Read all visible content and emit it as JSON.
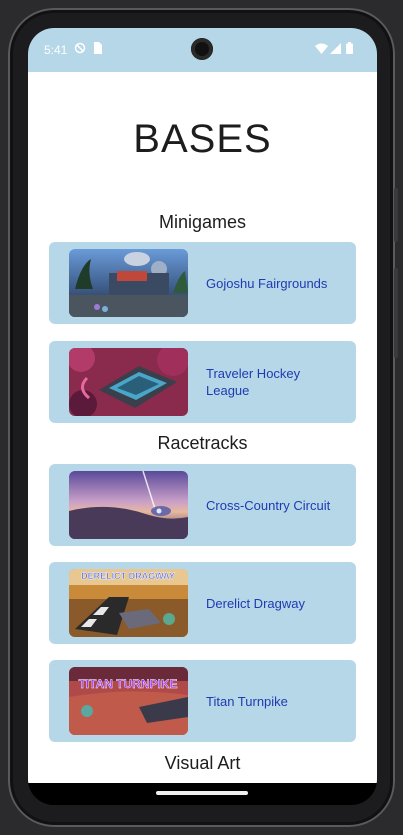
{
  "status_bar": {
    "time": "5:41"
  },
  "page": {
    "title": "BASES"
  },
  "sections": [
    {
      "title": "Minigames",
      "items": [
        {
          "label": "Gojoshu Fairgrounds"
        },
        {
          "label": "Traveler Hockey League"
        }
      ]
    },
    {
      "title": "Racetracks",
      "items": [
        {
          "label": "Cross-Country Circuit"
        },
        {
          "label": "Derelict Dragway"
        },
        {
          "label": "Titan Turnpike"
        }
      ]
    },
    {
      "title": "Visual Art"
    }
  ],
  "thumbnail_text": {
    "derelict": "DERELICT DRAGWAY",
    "titan": "TITAN TURNPIKE"
  }
}
